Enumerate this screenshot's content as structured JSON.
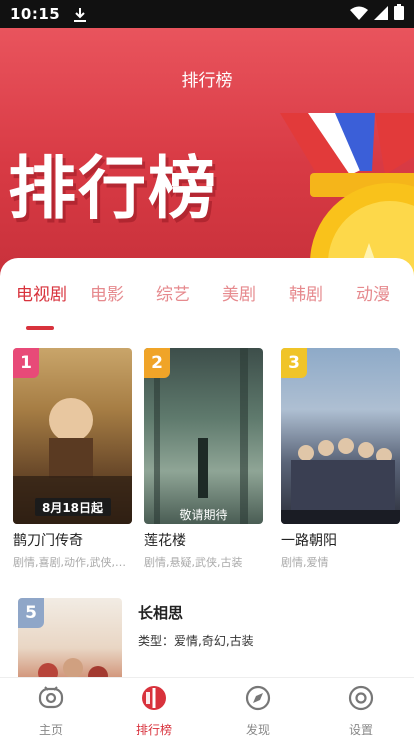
{
  "status_bar": {
    "time": "10:15"
  },
  "hero": {
    "title": "排行榜",
    "banner_text": "排行榜"
  },
  "tabs": [
    {
      "label": "电视剧",
      "active": true
    },
    {
      "label": "电影"
    },
    {
      "label": "综艺"
    },
    {
      "label": "美剧"
    },
    {
      "label": "韩剧"
    },
    {
      "label": "动漫"
    }
  ],
  "top3": [
    {
      "rank": "1",
      "title": "鹊刀门传奇",
      "tags": "剧情,喜剧,动作,武侠,古装",
      "poster_text": "8月18日起",
      "badge_color": "#e84a78"
    },
    {
      "rank": "2",
      "title": "莲花楼",
      "tags": "剧情,悬疑,武侠,古装",
      "poster_text": "敬请期待",
      "badge_color": "#f0a428"
    },
    {
      "rank": "3",
      "title": "一路朝阳",
      "tags": "剧情,爱情",
      "poster_text": "",
      "badge_color": "#f0c428"
    }
  ],
  "list": [
    {
      "rank": "5",
      "title": "长相思",
      "tags": "类型：爱情,奇幻,古装"
    }
  ],
  "bottom_nav": [
    {
      "label": "主页",
      "icon": "home-icon"
    },
    {
      "label": "排行榜",
      "icon": "ranking-icon",
      "active": true
    },
    {
      "label": "发现",
      "icon": "compass-icon"
    },
    {
      "label": "设置",
      "icon": "settings-icon"
    }
  ],
  "colors": {
    "accent": "#d8323c",
    "tab_inactive": "#e68a8e"
  }
}
